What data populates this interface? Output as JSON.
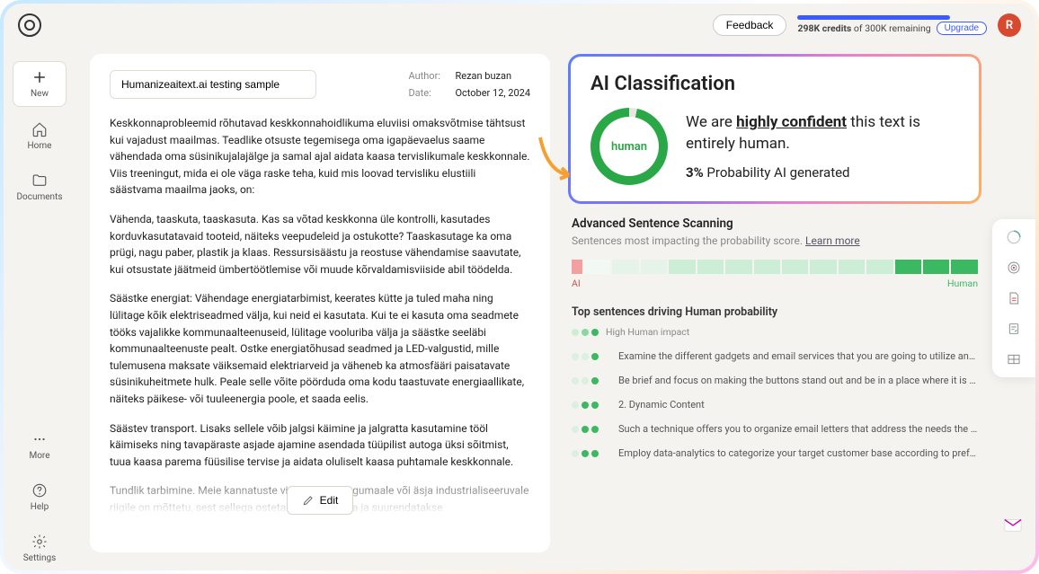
{
  "topbar": {
    "feedback": "Feedback",
    "credits_used": "298K credits",
    "credits_join": " of ",
    "credits_total": "300K",
    "credits_remaining": " remaining",
    "upgrade": "Upgrade",
    "avatar_initial": "R"
  },
  "sidebar": {
    "new": "New",
    "home": "Home",
    "documents": "Documents",
    "more": "More",
    "help": "Help",
    "settings": "Settings"
  },
  "doc": {
    "title": "Humanizeaitext.ai testing sample",
    "author_label": "Author:",
    "author": "Rezan buzan",
    "date_label": "Date:",
    "date": "October 12, 2024",
    "p1": "Keskkonnaprobleemid rõhutavad keskkonnahoidlikuma eluviisi omaksvõtmise tähtsust kui vajadust maailmas. Teadlike otsuste tegemisega oma igapäevaelus saame vähendada oma süsinikujalajälge ja samal ajal aidata kaasa tervislikumale keskkonnale. Viis treeningut, mida ei ole väga raske teha, kuid mis loovad tervisliku elustiili säästvama maailma jaoks, on:",
    "p2": "Vähenda, taaskuta, taaskasuta. Kas sa võtad keskkonna üle kontrolli, kasutades korduvkasutatavaid tooteid, näiteks veepudeleid ja ostukotte? Taaskasutage ka oma prügi, nagu paber, plastik ja klaas. Ressursisäästu ja reostuse vähendamise saavutate, kui otsustate jäätmeid ümbertöötlemise või muude kõrvaldamisviiside abil töödelda.",
    "p3": "Säästke energiat: Vähendage energiatarbimist, keerates kütte ja tuled maha ning lülitage kõik elektriseadmed välja, kui neid ei kasutata. Kui te ei kasuta oma seadmete tööks vajalikke kommunaalteenuseid, lülitage vooluriba välja ja säästke seeläbi kommunaalteenuste pealt. Ostke energiatõhusad seadmed ja LED-valgustid, mille tulemusena maksate väiksemaid elektriarveid ja väheneb ka atmosfääri paisatavate süsinikuheitmete hulk. Peale selle võite pöörduda oma kodu taastuvate energiaallikate, näiteks päikese- või tuuleenergia poole, et saada eelis.",
    "p4": "Säästev transport. Lisaks sellele võib jalgsi käimine ja jalgratta kasutamine tööl käimiseks ning tavapäraste asjade ajamine asendada tüüpilist autoga üksi sõitmist, tuua kaasa parema füüsilise tervise ja aidata oluliselt kaasa puhtamale keskkonnale.",
    "p5": "Tundlik tarbimine. Meie kannatuste viskamine arengumaale või äsja industrialiseeruvale riigile on mõttetu, sest sellega ostetakse ainult aega ja suurendatakse eksponentsiaalselt",
    "edit": "Edit"
  },
  "classification": {
    "title": "AI Classification",
    "gauge_label": "human",
    "sentence_pre": "We are ",
    "sentence_bold": "highly confident",
    "sentence_post": " this text is entirely human.",
    "prob_value": "3%",
    "prob_label": " Probability AI generated"
  },
  "scanning": {
    "title": "Advanced Sentence Scanning",
    "subtitle": "Sentences most impacting the probability score. ",
    "learn_more": "Learn more",
    "ai_label": "AI",
    "human_label": "Human",
    "top_title": "Top sentences driving Human probability",
    "legend": "High Human impact",
    "sentences": [
      "Examine the different gadgets and email services that you are going to utilize and assure that...",
      "Be brief and focus on making the buttons stand out and be in a place where it is easy for the...",
      "2. Dynamic Content",
      "Such a technique offers you to organize email letters that address the needs the best and,...",
      "Employ data-analytics to categorize your target customer base according to preferences,..."
    ]
  }
}
